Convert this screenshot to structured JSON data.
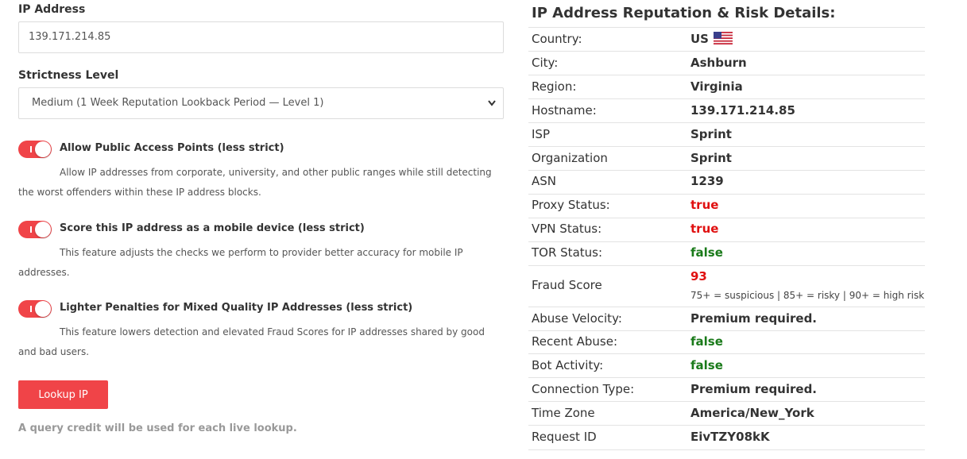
{
  "form": {
    "ip_label": "IP Address",
    "ip_value": "139.171.214.85",
    "strictness_label": "Strictness Level",
    "strictness_value": "Medium (1 Week Reputation Lookback Period — Level 1)",
    "options": [
      {
        "title": "Allow Public Access Points (less strict)",
        "desc": "Allow IP addresses from corporate, university, and other public ranges while still detecting the worst offenders within these IP address blocks.",
        "enabled": true
      },
      {
        "title": "Score this IP address as a mobile device (less strict)",
        "desc": "This feature adjusts the checks we perform to provider better accuracy for mobile IP addresses.",
        "enabled": true
      },
      {
        "title": "Lighter Penalties for Mixed Quality IP Addresses (less strict)",
        "desc": "This feature lowers detection and elevated Fraud Scores for IP addresses shared by good and bad users.",
        "enabled": true
      }
    ],
    "lookup_label": "Lookup IP",
    "credit_note": "A query credit will be used for each live lookup."
  },
  "colors": {
    "accent": "#f04448",
    "true_red": "#e01010",
    "false_green": "#1a7a1a"
  },
  "details": {
    "title": "IP Address Reputation & Risk Details:",
    "rows": [
      {
        "key": "Country:",
        "value": "US",
        "flag": "us-flag-icon"
      },
      {
        "key": "City:",
        "value": "Ashburn"
      },
      {
        "key": "Region:",
        "value": "Virginia"
      },
      {
        "key": "Hostname:",
        "value": "139.171.214.85"
      },
      {
        "key": "ISP",
        "value": "Sprint"
      },
      {
        "key": "Organization",
        "value": "Sprint"
      },
      {
        "key": "ASN",
        "value": "1239"
      },
      {
        "key": "Proxy Status:",
        "value": "true"
      },
      {
        "key": "VPN Status:",
        "value": "true"
      },
      {
        "key": "TOR Status:",
        "value": "false"
      },
      {
        "key": "Fraud Score",
        "value": "93",
        "note": "75+ = suspicious | 85+ = risky | 90+ = high risk"
      },
      {
        "key": "Abuse Velocity:",
        "value": "Premium required."
      },
      {
        "key": "Recent Abuse:",
        "value": "false"
      },
      {
        "key": "Bot Activity:",
        "value": "false"
      },
      {
        "key": "Connection Type:",
        "value": "Premium required."
      },
      {
        "key": "Time Zone",
        "value": "America/New_York"
      },
      {
        "key": "Request ID",
        "value": "EivTZY08kK"
      }
    ]
  }
}
